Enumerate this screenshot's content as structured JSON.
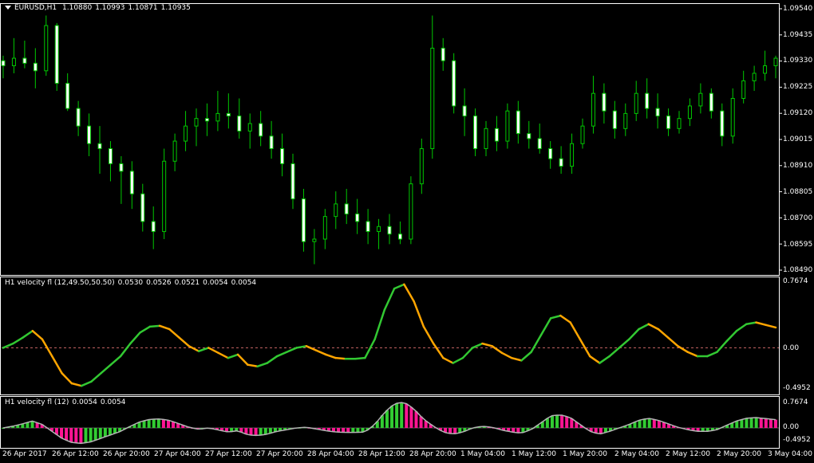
{
  "main_panel": {
    "symbol_timeframe": "EURUSD,H1",
    "ohlc": [
      "1.10880",
      "1.10993",
      "1.10871",
      "1.10935"
    ],
    "price_labels": [
      "1.09540",
      "1.09435",
      "1.09330",
      "1.09225",
      "1.09120",
      "1.09015",
      "1.08910",
      "1.08805",
      "1.08700",
      "1.08595",
      "1.08490"
    ]
  },
  "indicator1": {
    "title": "H1 velocity fl (12,49.50,50.50)",
    "values": [
      "0.0530",
      "0.0526",
      "0.0521",
      "0.0054",
      "0.0054"
    ],
    "scale_labels": [
      "0.7674",
      "0.00",
      "-0.4952"
    ]
  },
  "indicator2": {
    "title": "H1 velocity fl (12)",
    "values": [
      "0.0054",
      "0.0054"
    ],
    "scale_labels": [
      "0.7674",
      "0.00",
      "-0.4952"
    ]
  },
  "time_axis": [
    "26 Apr 2017",
    "26 Apr 12:00",
    "26 Apr 20:00",
    "27 Apr 04:00",
    "27 Apr 12:00",
    "27 Apr 20:00",
    "28 Apr 04:00",
    "28 Apr 12:00",
    "28 Apr 20:00",
    "1 May 04:00",
    "1 May 12:00",
    "1 May 20:00",
    "2 May 04:00",
    "2 May 12:00",
    "2 May 20:00",
    "3 May 04:00"
  ],
  "colors": {
    "background": "#000000",
    "candle_up": "#ffffff",
    "candle_down": "#ffffff",
    "wick": "#00c800",
    "line_up": "#32c832",
    "line_down": "#ffa500",
    "hist_up": "#32cd32",
    "hist_down": "#ff1493",
    "zero_line": "#c06060"
  },
  "chart_data": [
    {
      "type": "candlestick",
      "title": "EURUSD,H1",
      "ylim": [
        1.0849,
        1.0954
      ],
      "ohlc_path": [
        [
          1.0933,
          1.0935,
          1.0926,
          1.0931
        ],
        [
          1.0931,
          1.0942,
          1.0928,
          1.0934
        ],
        [
          1.0934,
          1.0941,
          1.093,
          1.0932
        ],
        [
          1.0932,
          1.0938,
          1.0922,
          1.0929
        ],
        [
          1.0929,
          1.0951,
          1.0927,
          1.0947
        ],
        [
          1.0947,
          1.0948,
          1.0921,
          1.0924
        ],
        [
          1.0924,
          1.0928,
          1.0913,
          1.0914
        ],
        [
          1.0914,
          1.0917,
          1.0903,
          1.0907
        ],
        [
          1.0907,
          1.0912,
          1.0895,
          1.09
        ],
        [
          1.09,
          1.0907,
          1.0888,
          1.0898
        ],
        [
          1.0898,
          1.0901,
          1.0885,
          1.0892
        ],
        [
          1.0892,
          1.0895,
          1.0876,
          1.0889
        ],
        [
          1.0889,
          1.0893,
          1.0874,
          1.088
        ],
        [
          1.088,
          1.0884,
          1.0865,
          1.0869
        ],
        [
          1.0869,
          1.0875,
          1.0858,
          1.0865
        ],
        [
          1.0865,
          1.0898,
          1.0862,
          1.0893
        ],
        [
          1.0893,
          1.0904,
          1.0889,
          1.0901
        ],
        [
          1.0901,
          1.0913,
          1.0897,
          1.0907
        ],
        [
          1.0907,
          1.0914,
          1.0899,
          1.091
        ],
        [
          1.091,
          1.0916,
          1.0903,
          1.0909
        ],
        [
          1.0909,
          1.0921,
          1.0905,
          1.0912
        ],
        [
          1.0912,
          1.092,
          1.0906,
          1.0911
        ],
        [
          1.0911,
          1.0918,
          1.0902,
          1.0905
        ],
        [
          1.0905,
          1.0912,
          1.0898,
          1.0908
        ],
        [
          1.0908,
          1.0913,
          1.0899,
          1.0903
        ],
        [
          1.0903,
          1.0909,
          1.0894,
          1.0898
        ],
        [
          1.0898,
          1.0904,
          1.0887,
          1.0892
        ],
        [
          1.0892,
          1.0896,
          1.0874,
          1.0878
        ],
        [
          1.0878,
          1.0882,
          1.0857,
          1.0861
        ],
        [
          1.0861,
          1.0866,
          1.0852,
          1.0862
        ],
        [
          1.0862,
          1.0874,
          1.0858,
          1.0871
        ],
        [
          1.0871,
          1.0881,
          1.0866,
          1.0876
        ],
        [
          1.0876,
          1.0882,
          1.0868,
          1.0872
        ],
        [
          1.0872,
          1.0878,
          1.0864,
          1.0869
        ],
        [
          1.0869,
          1.0874,
          1.086,
          1.0865
        ],
        [
          1.0865,
          1.087,
          1.0858,
          1.0867
        ],
        [
          1.0867,
          1.0872,
          1.086,
          1.0864
        ],
        [
          1.0864,
          1.0869,
          1.086,
          1.0862
        ],
        [
          1.0862,
          1.0887,
          1.086,
          1.0884
        ],
        [
          1.0884,
          1.0902,
          1.088,
          1.0898
        ],
        [
          1.0898,
          1.0951,
          1.0894,
          1.0938
        ],
        [
          1.0938,
          1.0942,
          1.0929,
          1.0933
        ],
        [
          1.0933,
          1.0936,
          1.0912,
          1.0915
        ],
        [
          1.0915,
          1.0922,
          1.0903,
          1.0911
        ],
        [
          1.0911,
          1.0914,
          1.0895,
          1.0898
        ],
        [
          1.0898,
          1.0909,
          1.0895,
          1.0906
        ],
        [
          1.0906,
          1.0911,
          1.0897,
          1.0901
        ],
        [
          1.0901,
          1.0916,
          1.0898,
          1.0913
        ],
        [
          1.0913,
          1.0917,
          1.09,
          1.0904
        ],
        [
          1.0904,
          1.0909,
          1.0898,
          1.0902
        ],
        [
          1.0902,
          1.0908,
          1.0896,
          1.0898
        ],
        [
          1.0898,
          1.0901,
          1.089,
          1.0894
        ],
        [
          1.0894,
          1.0899,
          1.0888,
          1.0891
        ],
        [
          1.0891,
          1.0904,
          1.0888,
          1.09
        ],
        [
          1.09,
          1.091,
          1.0898,
          1.0907
        ],
        [
          1.0907,
          1.0927,
          1.0904,
          1.092
        ],
        [
          1.092,
          1.0924,
          1.0908,
          1.0913
        ],
        [
          1.0913,
          1.0917,
          1.0902,
          1.0906
        ],
        [
          1.0906,
          1.0916,
          1.0903,
          1.0912
        ],
        [
          1.0912,
          1.0925,
          1.0909,
          1.092
        ],
        [
          1.092,
          1.0926,
          1.091,
          1.0914
        ],
        [
          1.0914,
          1.092,
          1.0906,
          1.0911
        ],
        [
          1.0911,
          1.0914,
          1.0903,
          1.0906
        ],
        [
          1.0906,
          1.0913,
          1.0904,
          1.091
        ],
        [
          1.091,
          1.0918,
          1.0907,
          1.0915
        ],
        [
          1.0915,
          1.0924,
          1.0912,
          1.092
        ],
        [
          1.092,
          1.0922,
          1.091,
          1.0913
        ],
        [
          1.0913,
          1.0916,
          1.0899,
          1.0903
        ],
        [
          1.0903,
          1.0922,
          1.09,
          1.0918
        ],
        [
          1.0918,
          1.0929,
          1.0916,
          1.0925
        ],
        [
          1.0925,
          1.0931,
          1.0921,
          1.0928
        ],
        [
          1.0928,
          1.0937,
          1.0925,
          1.0931
        ],
        [
          1.0931,
          1.0935,
          1.0926,
          1.0934
        ]
      ]
    },
    {
      "type": "line",
      "title": "H1 velocity fl (12,49.50,50.50)",
      "ylim": [
        -0.4952,
        0.7674
      ],
      "values": [
        0.0,
        0.05,
        0.12,
        0.2,
        0.1,
        -0.1,
        -0.3,
        -0.42,
        -0.45,
        -0.4,
        -0.3,
        -0.2,
        -0.1,
        0.05,
        0.18,
        0.25,
        0.26,
        0.22,
        0.12,
        0.02,
        -0.04,
        0.0,
        -0.06,
        -0.12,
        -0.08,
        -0.2,
        -0.22,
        -0.18,
        -0.1,
        -0.05,
        0.0,
        0.02,
        -0.03,
        -0.08,
        -0.12,
        -0.13,
        -0.13,
        -0.12,
        0.1,
        0.45,
        0.7,
        0.75,
        0.55,
        0.25,
        0.05,
        -0.12,
        -0.18,
        -0.12,
        0.0,
        0.05,
        0.02,
        -0.06,
        -0.12,
        -0.15,
        -0.05,
        0.15,
        0.35,
        0.38,
        0.3,
        0.1,
        -0.1,
        -0.18,
        -0.1,
        0.0,
        0.1,
        0.22,
        0.28,
        0.22,
        0.12,
        0.02,
        -0.05,
        -0.1,
        -0.1,
        -0.05,
        0.08,
        0.2,
        0.28,
        0.3,
        0.27,
        0.24
      ]
    },
    {
      "type": "bar",
      "title": "H1 velocity fl (12)",
      "ylim": [
        -0.4952,
        0.7674
      ]
    }
  ]
}
